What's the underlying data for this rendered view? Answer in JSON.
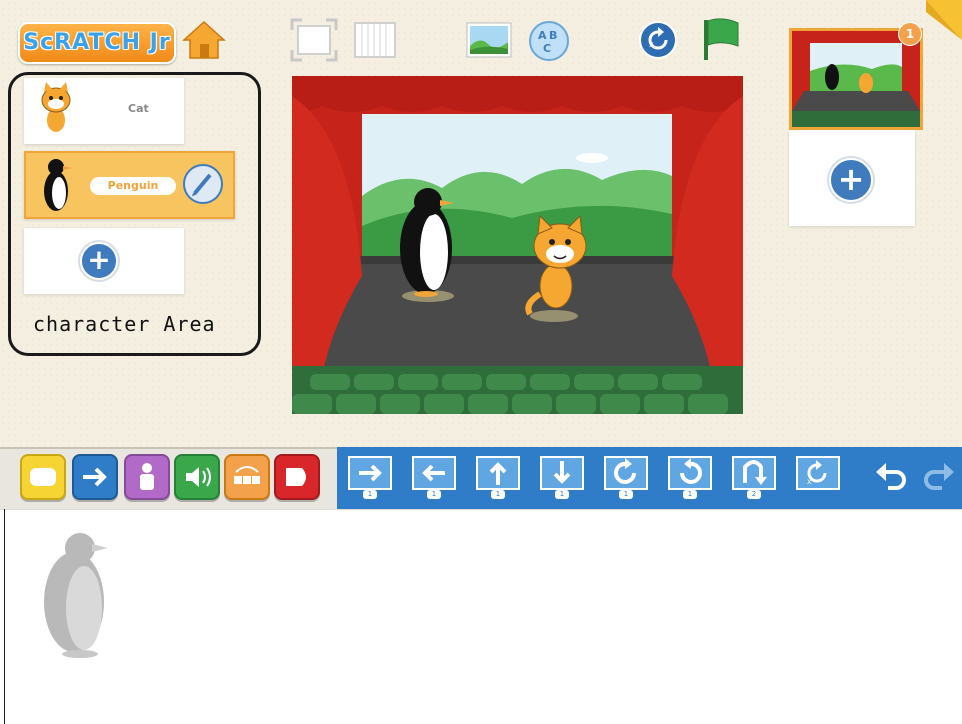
{
  "app": {
    "logo_text": "ScRATCH Jr"
  },
  "characters": [
    {
      "name": "Cat"
    },
    {
      "name": "Penguin"
    }
  ],
  "annotation": {
    "character_area_label": "character Area"
  },
  "pages": {
    "badge_count": "1"
  },
  "palette": {
    "categories": [
      "triggering-blocks",
      "motion-blocks",
      "looks-blocks",
      "sound-blocks",
      "control-blocks",
      "end-blocks"
    ]
  },
  "motion_blocks": [
    {
      "name": "move-right",
      "number": "1"
    },
    {
      "name": "move-left",
      "number": "1"
    },
    {
      "name": "move-up",
      "number": "1"
    },
    {
      "name": "move-down",
      "number": "1"
    },
    {
      "name": "turn-right",
      "number": "1"
    },
    {
      "name": "turn-left",
      "number": "1"
    },
    {
      "name": "hop",
      "number": "2"
    },
    {
      "name": "go-home",
      "number": ""
    }
  ],
  "colors": {
    "accent": "#f0a53a",
    "motion": "#2f7dc8",
    "curtain": "#c6231a",
    "flag": "#3aa84a"
  }
}
